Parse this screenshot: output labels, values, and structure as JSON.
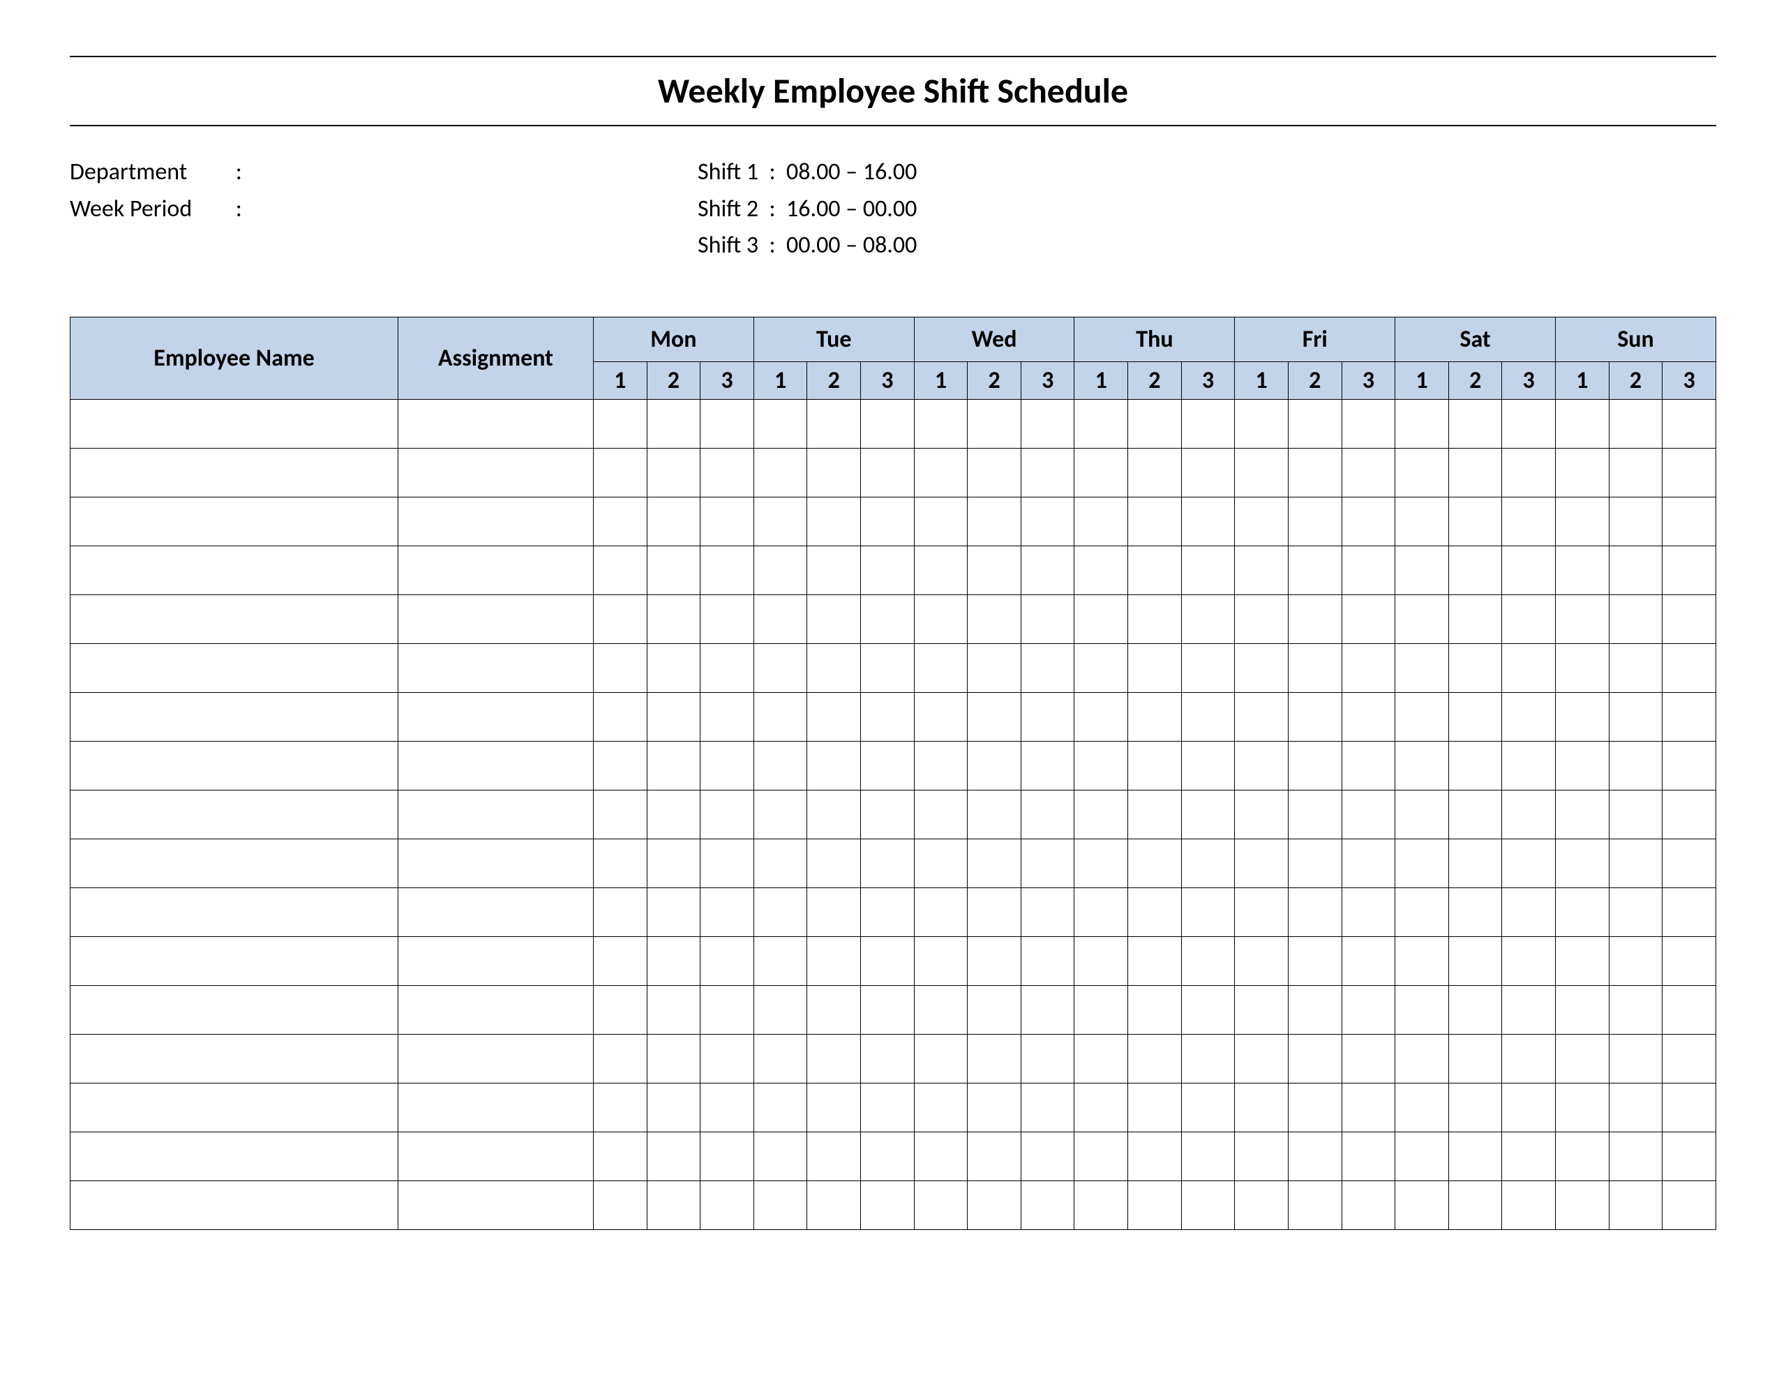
{
  "title": "Weekly Employee Shift Schedule",
  "info": {
    "department_label": "Department",
    "department_sep": ":",
    "department_value": "",
    "week_period_label": "Week  Period",
    "week_period_sep": ":",
    "week_period_value": "",
    "shift1_label": "Shift 1",
    "shift1_sep": ":",
    "shift1_value": "08.00  – 16.00",
    "shift2_label": "Shift 2",
    "shift2_sep": ":",
    "shift2_value": "16.00  – 00.00",
    "shift3_label": "Shift 3",
    "shift3_sep": ":",
    "shift3_value": "00.00  – 08.00"
  },
  "headers": {
    "employee_name": "Employee Name",
    "assignment": "Assignment",
    "days": [
      "Mon",
      "Tue",
      "Wed",
      "Thu",
      "Fri",
      "Sat",
      "Sun"
    ],
    "shifts": [
      "1",
      "2",
      "3"
    ]
  },
  "row_count": 17
}
